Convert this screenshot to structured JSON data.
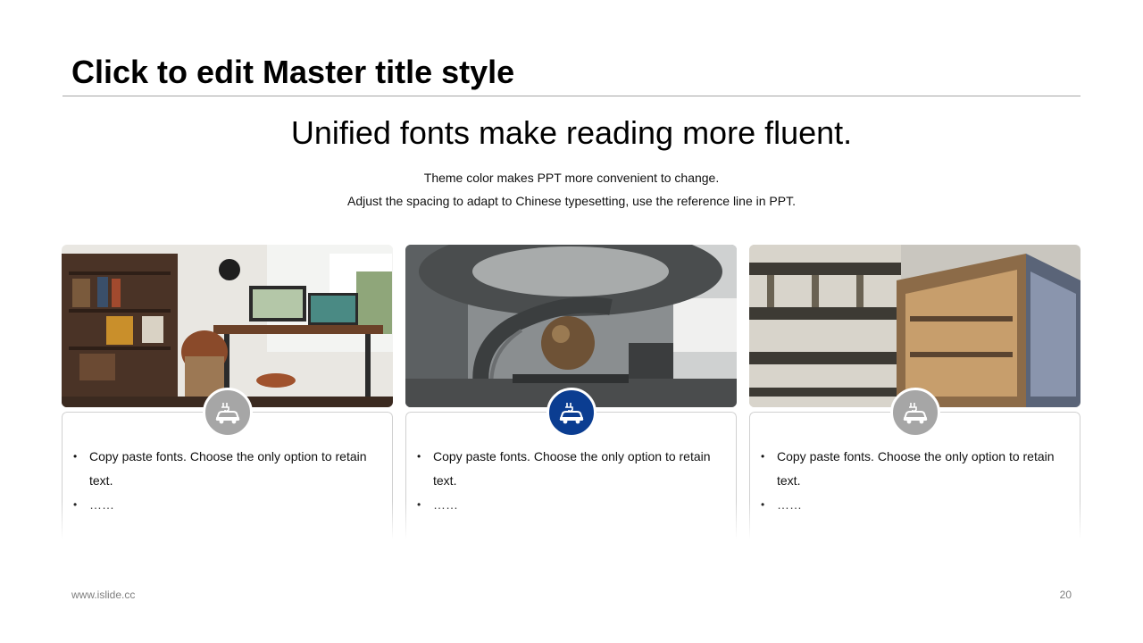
{
  "slide": {
    "title": "Click to edit Master title style",
    "subtitle": "Unified fonts make reading more fluent.",
    "description_lines": [
      "Theme color makes PPT more convenient  to change.",
      "Adjust  the spacing  to adapt to Chinese  typesetting,  use the  reference line  in PPT."
    ]
  },
  "colors": {
    "accent": "#0b3d91",
    "badge_inactive": "#a6a6a6",
    "rule": "#a6a6a6"
  },
  "cards": [
    {
      "photo": "home-office-desk-photo",
      "icon": "electric-car-icon",
      "active": false,
      "bullets": [
        "Copy paste fonts. Choose the only option to retain text.",
        "……"
      ]
    },
    {
      "photo": "spiral-staircase-sphere-photo",
      "icon": "electric-car-icon",
      "active": true,
      "bullets": [
        "Copy paste fonts. Choose the only option to retain text.",
        "……"
      ]
    },
    {
      "photo": "glass-building-facade-photo",
      "icon": "electric-car-icon",
      "active": false,
      "bullets": [
        "Copy paste fonts. Choose the only option to retain text.",
        "……"
      ]
    }
  ],
  "footer": {
    "website": "www.islide.cc",
    "page_number": "20"
  }
}
